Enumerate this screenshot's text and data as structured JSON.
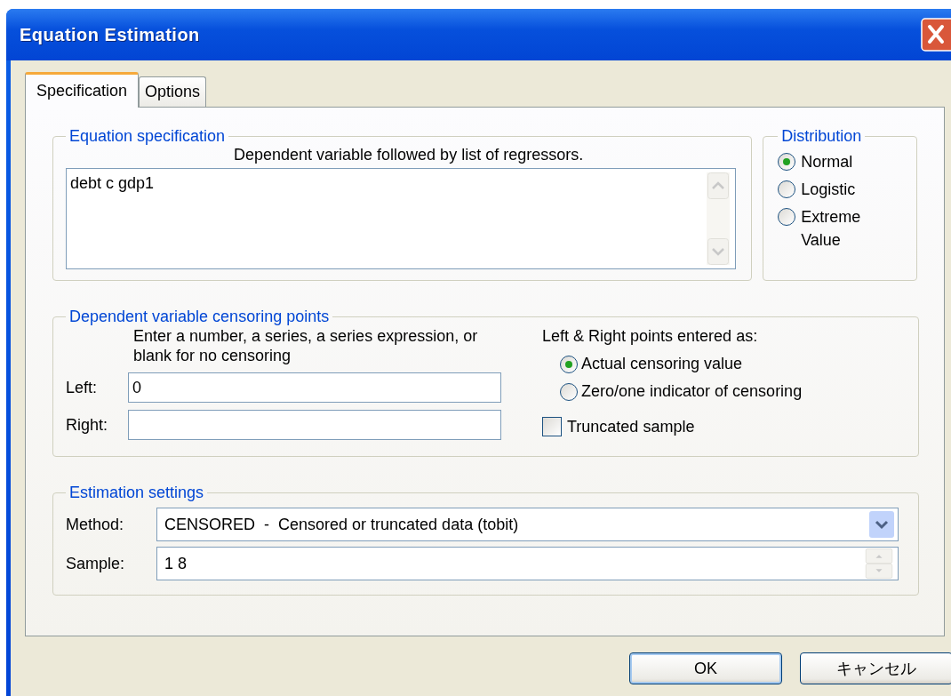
{
  "window": {
    "title": "Equation Estimation"
  },
  "tabs": [
    {
      "label": "Specification",
      "selected": true
    },
    {
      "label": "Options",
      "selected": false
    }
  ],
  "equation_specification": {
    "legend": "Equation specification",
    "instruction": "Dependent variable followed by list of regressors.",
    "value": "debt c gdp1"
  },
  "distribution": {
    "legend": "Distribution",
    "options": [
      {
        "label": "Normal",
        "selected": true
      },
      {
        "label": "Logistic",
        "selected": false
      },
      {
        "label": "Extreme Value",
        "selected": false
      }
    ]
  },
  "censoring": {
    "legend": "Dependent variable censoring points",
    "instruction": "Enter a number, a series, a series expression, or blank for no censoring",
    "fields": [
      {
        "label": "Left:",
        "value": "0"
      },
      {
        "label": "Right:"
      }
    ],
    "entered_as_label": "Left & Right points entered as:",
    "entered_as": [
      {
        "label": "Actual censoring value",
        "selected": true
      },
      {
        "label": "Zero/one indicator of censoring",
        "selected": false
      }
    ],
    "truncated": {
      "label": "Truncated sample",
      "checked": false
    }
  },
  "estimation": {
    "legend": "Estimation settings",
    "method": {
      "label": "Method:",
      "value": "CENSORED  -  Censored or truncated data (tobit)"
    },
    "sample": {
      "label": "Sample:",
      "value": "1 8"
    }
  },
  "buttons": [
    {
      "label": "OK",
      "kind": "default"
    },
    {
      "label": "キャンセル",
      "kind": "normal"
    }
  ]
}
